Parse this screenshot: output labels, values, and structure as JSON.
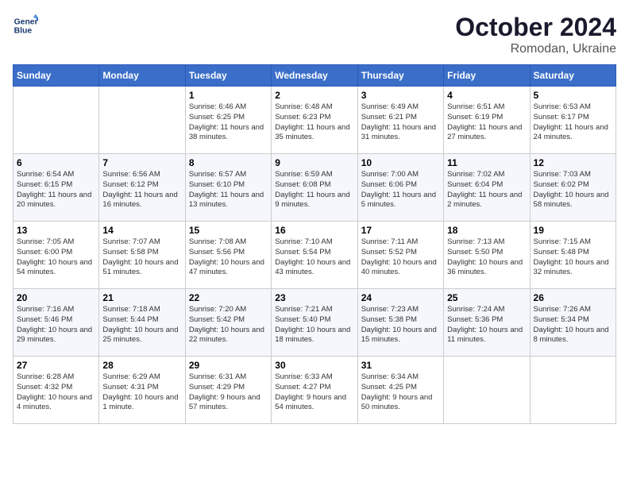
{
  "logo": {
    "text_line1": "General",
    "text_line2": "Blue"
  },
  "title": "October 2024",
  "subtitle": "Romodan, Ukraine",
  "days_of_week": [
    "Sunday",
    "Monday",
    "Tuesday",
    "Wednesday",
    "Thursday",
    "Friday",
    "Saturday"
  ],
  "weeks": [
    [
      {
        "day": null
      },
      {
        "day": null
      },
      {
        "day": "1",
        "sunrise": "Sunrise: 6:46 AM",
        "sunset": "Sunset: 6:25 PM",
        "daylight": "Daylight: 11 hours and 38 minutes."
      },
      {
        "day": "2",
        "sunrise": "Sunrise: 6:48 AM",
        "sunset": "Sunset: 6:23 PM",
        "daylight": "Daylight: 11 hours and 35 minutes."
      },
      {
        "day": "3",
        "sunrise": "Sunrise: 6:49 AM",
        "sunset": "Sunset: 6:21 PM",
        "daylight": "Daylight: 11 hours and 31 minutes."
      },
      {
        "day": "4",
        "sunrise": "Sunrise: 6:51 AM",
        "sunset": "Sunset: 6:19 PM",
        "daylight": "Daylight: 11 hours and 27 minutes."
      },
      {
        "day": "5",
        "sunrise": "Sunrise: 6:53 AM",
        "sunset": "Sunset: 6:17 PM",
        "daylight": "Daylight: 11 hours and 24 minutes."
      }
    ],
    [
      {
        "day": "6",
        "sunrise": "Sunrise: 6:54 AM",
        "sunset": "Sunset: 6:15 PM",
        "daylight": "Daylight: 11 hours and 20 minutes."
      },
      {
        "day": "7",
        "sunrise": "Sunrise: 6:56 AM",
        "sunset": "Sunset: 6:12 PM",
        "daylight": "Daylight: 11 hours and 16 minutes."
      },
      {
        "day": "8",
        "sunrise": "Sunrise: 6:57 AM",
        "sunset": "Sunset: 6:10 PM",
        "daylight": "Daylight: 11 hours and 13 minutes."
      },
      {
        "day": "9",
        "sunrise": "Sunrise: 6:59 AM",
        "sunset": "Sunset: 6:08 PM",
        "daylight": "Daylight: 11 hours and 9 minutes."
      },
      {
        "day": "10",
        "sunrise": "Sunrise: 7:00 AM",
        "sunset": "Sunset: 6:06 PM",
        "daylight": "Daylight: 11 hours and 5 minutes."
      },
      {
        "day": "11",
        "sunrise": "Sunrise: 7:02 AM",
        "sunset": "Sunset: 6:04 PM",
        "daylight": "Daylight: 11 hours and 2 minutes."
      },
      {
        "day": "12",
        "sunrise": "Sunrise: 7:03 AM",
        "sunset": "Sunset: 6:02 PM",
        "daylight": "Daylight: 10 hours and 58 minutes."
      }
    ],
    [
      {
        "day": "13",
        "sunrise": "Sunrise: 7:05 AM",
        "sunset": "Sunset: 6:00 PM",
        "daylight": "Daylight: 10 hours and 54 minutes."
      },
      {
        "day": "14",
        "sunrise": "Sunrise: 7:07 AM",
        "sunset": "Sunset: 5:58 PM",
        "daylight": "Daylight: 10 hours and 51 minutes."
      },
      {
        "day": "15",
        "sunrise": "Sunrise: 7:08 AM",
        "sunset": "Sunset: 5:56 PM",
        "daylight": "Daylight: 10 hours and 47 minutes."
      },
      {
        "day": "16",
        "sunrise": "Sunrise: 7:10 AM",
        "sunset": "Sunset: 5:54 PM",
        "daylight": "Daylight: 10 hours and 43 minutes."
      },
      {
        "day": "17",
        "sunrise": "Sunrise: 7:11 AM",
        "sunset": "Sunset: 5:52 PM",
        "daylight": "Daylight: 10 hours and 40 minutes."
      },
      {
        "day": "18",
        "sunrise": "Sunrise: 7:13 AM",
        "sunset": "Sunset: 5:50 PM",
        "daylight": "Daylight: 10 hours and 36 minutes."
      },
      {
        "day": "19",
        "sunrise": "Sunrise: 7:15 AM",
        "sunset": "Sunset: 5:48 PM",
        "daylight": "Daylight: 10 hours and 32 minutes."
      }
    ],
    [
      {
        "day": "20",
        "sunrise": "Sunrise: 7:16 AM",
        "sunset": "Sunset: 5:46 PM",
        "daylight": "Daylight: 10 hours and 29 minutes."
      },
      {
        "day": "21",
        "sunrise": "Sunrise: 7:18 AM",
        "sunset": "Sunset: 5:44 PM",
        "daylight": "Daylight: 10 hours and 25 minutes."
      },
      {
        "day": "22",
        "sunrise": "Sunrise: 7:20 AM",
        "sunset": "Sunset: 5:42 PM",
        "daylight": "Daylight: 10 hours and 22 minutes."
      },
      {
        "day": "23",
        "sunrise": "Sunrise: 7:21 AM",
        "sunset": "Sunset: 5:40 PM",
        "daylight": "Daylight: 10 hours and 18 minutes."
      },
      {
        "day": "24",
        "sunrise": "Sunrise: 7:23 AM",
        "sunset": "Sunset: 5:38 PM",
        "daylight": "Daylight: 10 hours and 15 minutes."
      },
      {
        "day": "25",
        "sunrise": "Sunrise: 7:24 AM",
        "sunset": "Sunset: 5:36 PM",
        "daylight": "Daylight: 10 hours and 11 minutes."
      },
      {
        "day": "26",
        "sunrise": "Sunrise: 7:26 AM",
        "sunset": "Sunset: 5:34 PM",
        "daylight": "Daylight: 10 hours and 8 minutes."
      }
    ],
    [
      {
        "day": "27",
        "sunrise": "Sunrise: 6:28 AM",
        "sunset": "Sunset: 4:32 PM",
        "daylight": "Daylight: 10 hours and 4 minutes."
      },
      {
        "day": "28",
        "sunrise": "Sunrise: 6:29 AM",
        "sunset": "Sunset: 4:31 PM",
        "daylight": "Daylight: 10 hours and 1 minute."
      },
      {
        "day": "29",
        "sunrise": "Sunrise: 6:31 AM",
        "sunset": "Sunset: 4:29 PM",
        "daylight": "Daylight: 9 hours and 57 minutes."
      },
      {
        "day": "30",
        "sunrise": "Sunrise: 6:33 AM",
        "sunset": "Sunset: 4:27 PM",
        "daylight": "Daylight: 9 hours and 54 minutes."
      },
      {
        "day": "31",
        "sunrise": "Sunrise: 6:34 AM",
        "sunset": "Sunset: 4:25 PM",
        "daylight": "Daylight: 9 hours and 50 minutes."
      },
      {
        "day": null
      },
      {
        "day": null
      }
    ]
  ]
}
